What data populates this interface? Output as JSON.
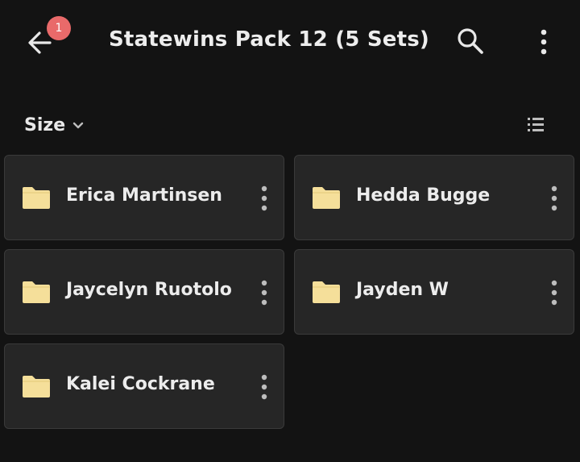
{
  "header": {
    "title": "Statewins Pack 12 (5 Sets)",
    "notification_count": "1",
    "back_icon": "arrow-left-icon",
    "search_icon": "search-icon",
    "more_icon": "more-vertical-icon"
  },
  "sort": {
    "label": "Size",
    "chevron_icon": "chevron-down-icon",
    "view_icon": "list-view-icon"
  },
  "folders": [
    {
      "name": "Erica Martinsen"
    },
    {
      "name": "Hedda Bugge"
    },
    {
      "name": "Jaycelyn Ruotolo"
    },
    {
      "name": "Jayden W"
    },
    {
      "name": "Kalei Cockrane"
    }
  ],
  "colors": {
    "background": "#131313",
    "card": "#262626",
    "folder": "#f5df9a",
    "badge": "#e96a6a",
    "text": "#ececec"
  }
}
